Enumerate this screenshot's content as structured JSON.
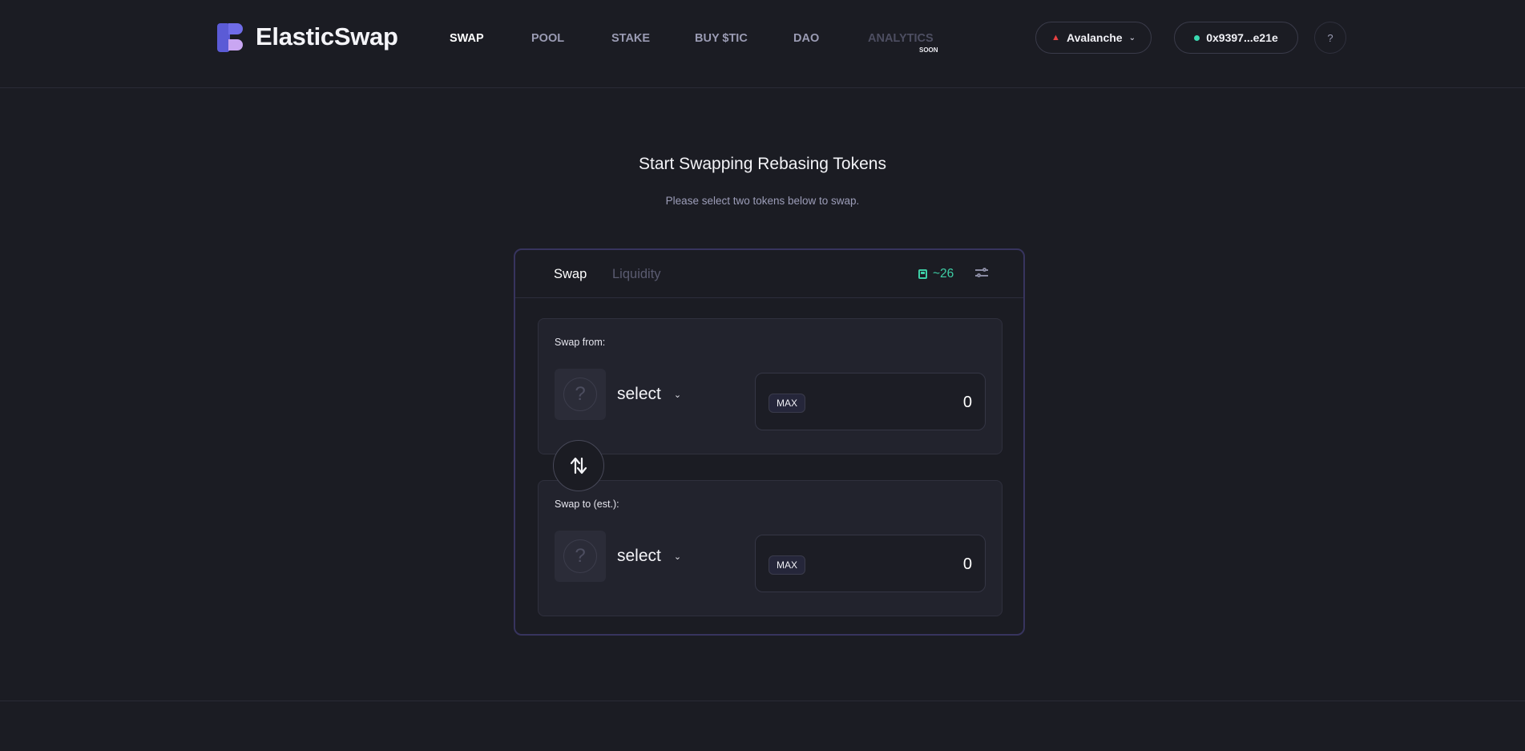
{
  "brand": {
    "name": "ElasticSwap"
  },
  "nav": {
    "items": [
      {
        "label": "SWAP",
        "state": "active"
      },
      {
        "label": "POOL",
        "state": "normal"
      },
      {
        "label": "STAKE",
        "state": "normal"
      },
      {
        "label": "BUY $TIC",
        "state": "normal"
      },
      {
        "label": "DAO",
        "state": "normal"
      },
      {
        "label": "ANALYTICS",
        "state": "disabled",
        "badge": "SOON"
      }
    ]
  },
  "network": {
    "label": "Avalanche",
    "icon": "avalanche-icon"
  },
  "wallet": {
    "address": "0x9397...e21e",
    "status_color": "#3ad9b1"
  },
  "help": {
    "label": "?"
  },
  "hero": {
    "title": "Start Swapping Rebasing Tokens",
    "subtitle": "Please select two tokens below to swap."
  },
  "card": {
    "tabs": [
      {
        "label": "Swap",
        "active": true
      },
      {
        "label": "Liquidity",
        "active": false
      }
    ],
    "gas": {
      "value": "~26",
      "icon": "gas-pump-icon"
    },
    "settings_icon": "sliders-icon"
  },
  "swap_from": {
    "label": "Swap from:",
    "token_placeholder": "?",
    "select_label": "select",
    "max_label": "MAX",
    "amount": "0"
  },
  "swap_to": {
    "label": "Swap to (est.):",
    "token_placeholder": "?",
    "select_label": "select",
    "max_label": "MAX",
    "amount": "0"
  },
  "colors": {
    "background": "#1b1c23",
    "accent_green": "#3ecfa6",
    "card_border": "#37345e",
    "brand_purple": "#5b5bd6"
  }
}
